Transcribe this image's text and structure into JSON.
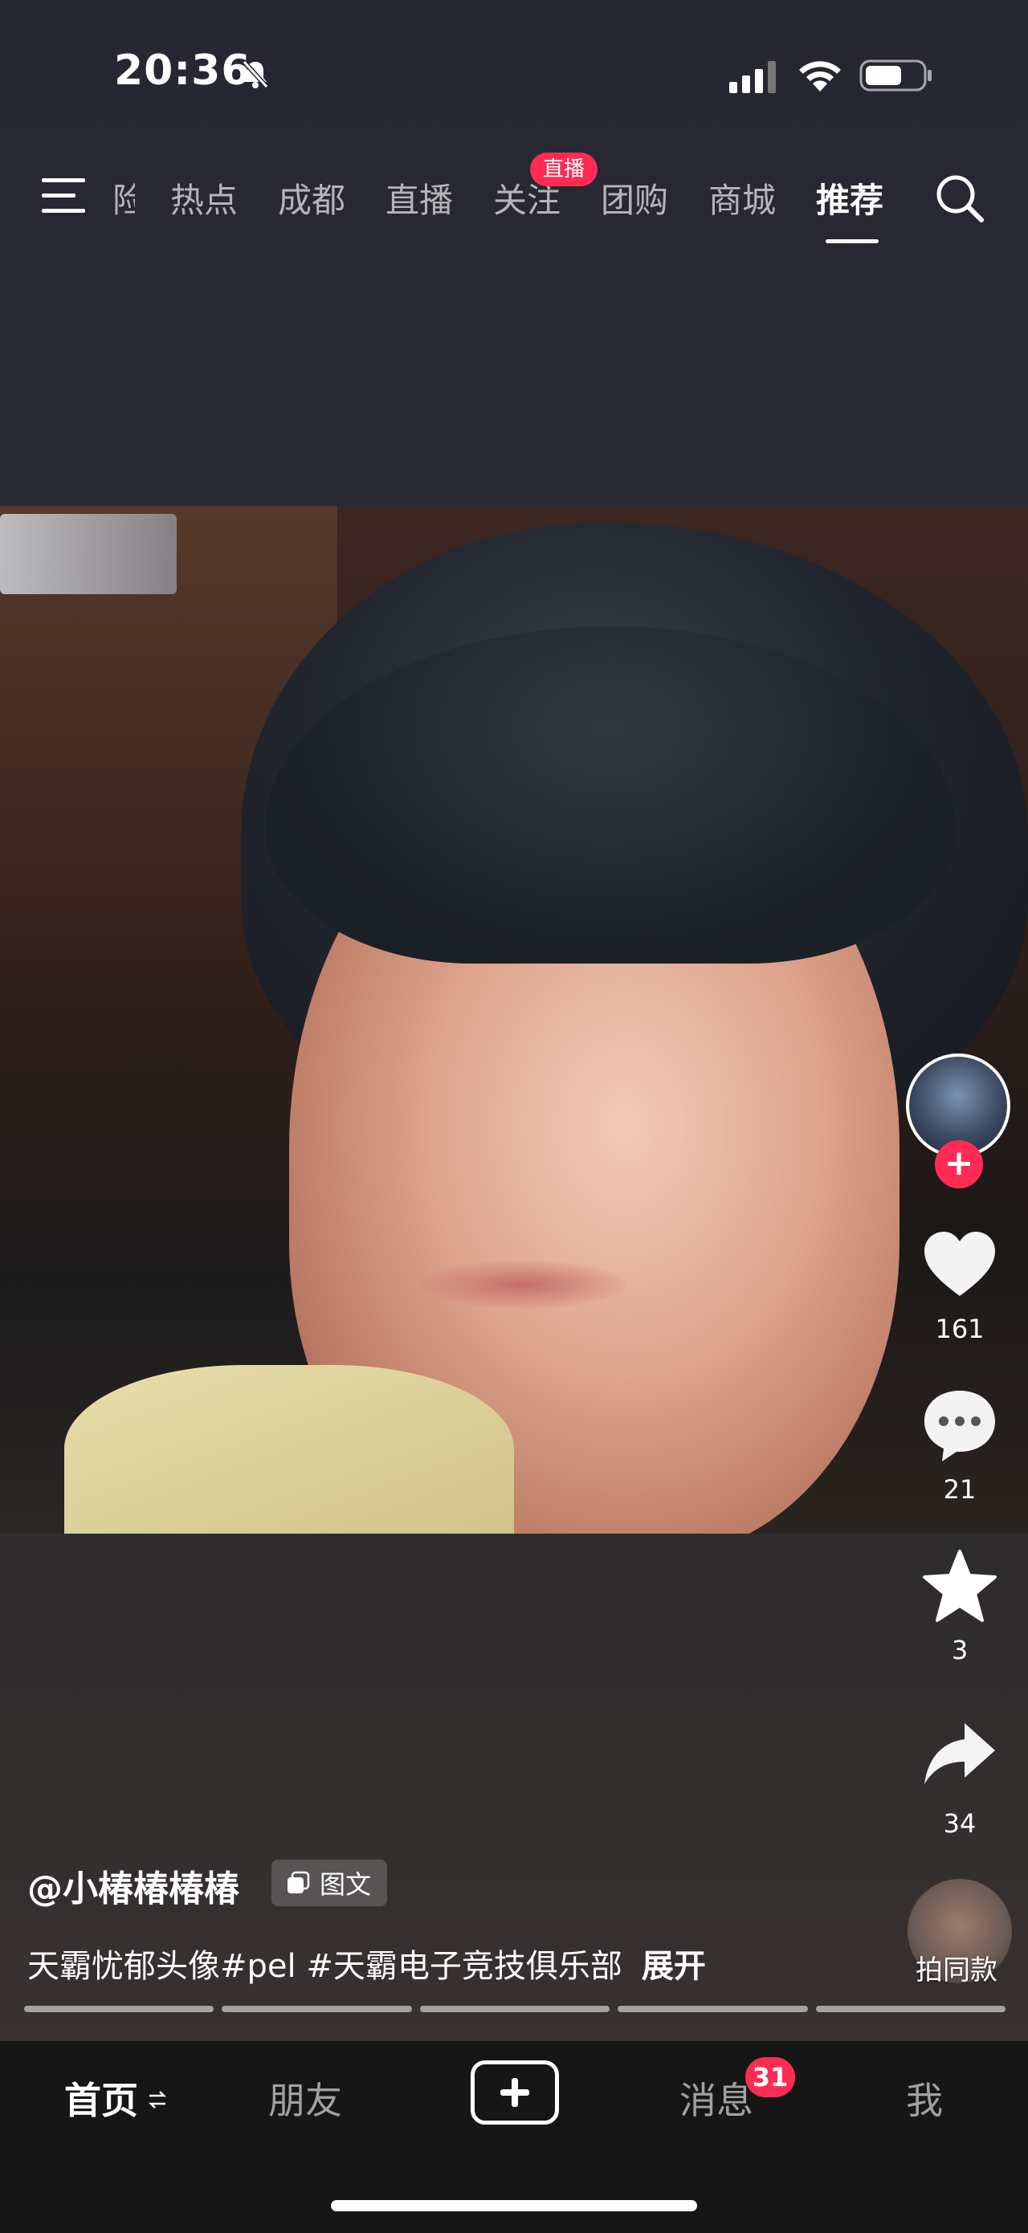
{
  "status_bar": {
    "time": "20:36",
    "icons": [
      "bell-muted-icon",
      "cellular-signal-icon",
      "wifi-icon",
      "battery-icon"
    ]
  },
  "top_nav": {
    "partial_tab": "险",
    "tabs": [
      "热点",
      "成都",
      "直播",
      "关注",
      "团购",
      "商城",
      "推荐"
    ],
    "active_tab": "推荐",
    "live_badge": "直播"
  },
  "post": {
    "author": "@小椿椿椿椿",
    "type_chip": "图文",
    "caption": "天霸忧郁头像#pel #天霸电子竞技俱乐部",
    "expand_label": "展开",
    "image_count": 5
  },
  "actions": {
    "likes": "161",
    "comments": "21",
    "favorites": "3",
    "shares": "34",
    "same_style_label": "拍同款"
  },
  "bottom_nav": {
    "home": "首页",
    "friends": "朋友",
    "messages": "消息",
    "messages_badge": "31",
    "me": "我"
  },
  "colors": {
    "accent": "#fe2c55",
    "tabbar_bg": "#161616"
  }
}
